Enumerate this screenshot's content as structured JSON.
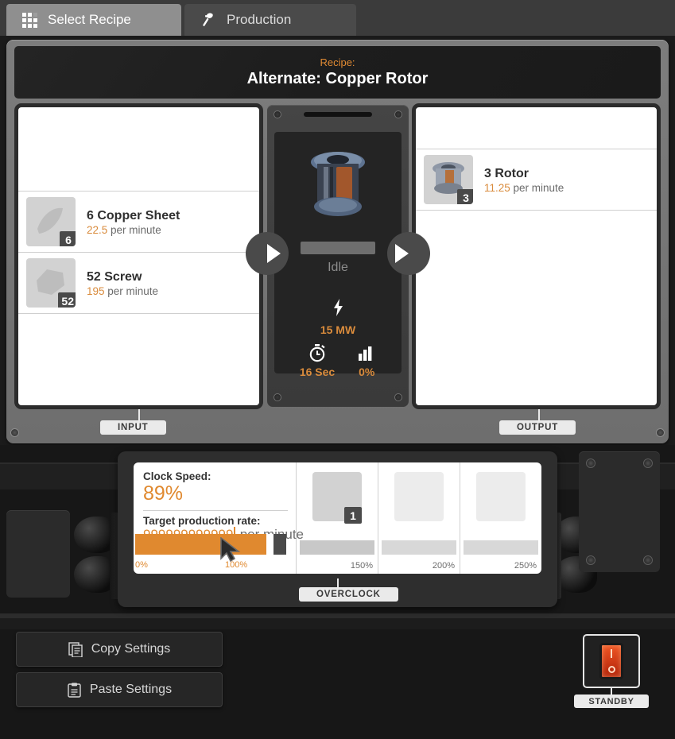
{
  "tabs": [
    {
      "label": "Select Recipe",
      "icon": "grid-icon",
      "active": true
    },
    {
      "label": "Production",
      "icon": "hammer-icon",
      "active": false
    }
  ],
  "recipe": {
    "kicker": "Recipe:",
    "title": "Alternate: Copper Rotor"
  },
  "input": {
    "tag": "INPUT",
    "slots": [
      {
        "name": "6 Copper Sheet",
        "count": "6",
        "rate_value": "22.5",
        "rate_suffix": " per minute"
      },
      {
        "name": "52 Screw",
        "count": "52",
        "rate_value": "195",
        "rate_suffix": " per minute"
      }
    ]
  },
  "output": {
    "tag": "OUTPUT",
    "slots": [
      {
        "name": "3 Rotor",
        "count": "3",
        "rate_value": "11.25",
        "rate_suffix": " per minute"
      }
    ]
  },
  "machine": {
    "state": "Idle",
    "power_icon": "lightning-bolt-icon",
    "power": "15 MW",
    "time_icon": "stopwatch-icon",
    "time": "16 Sec",
    "efficiency_icon": "bar-chart-icon",
    "efficiency": "0%",
    "prev_icon": "arrow-right-icon",
    "next_icon": "arrow-right-icon"
  },
  "overclock": {
    "tag": "OVERCLOCK",
    "clock_speed_label": "Clock Speed:",
    "clock_speed_value": "89%",
    "target_rate_label": "Target production rate:",
    "target_rate_value": "999999999999",
    "target_rate_suffix": " per minute",
    "slider": {
      "min_label": "0%",
      "max_label": "100%",
      "fill_percent": 89
    },
    "shards": [
      {
        "count": "1",
        "percent_label": "150%",
        "filled": true
      },
      {
        "count": "",
        "percent_label": "200%",
        "filled": false
      },
      {
        "count": "",
        "percent_label": "250%",
        "filled": false
      }
    ]
  },
  "footer": {
    "copy_label": "Copy Settings",
    "copy_icon": "document-copy-icon",
    "paste_label": "Paste Settings",
    "paste_icon": "clipboard-paste-icon",
    "standby_label": "STANDBY",
    "standby_icon": "power-rocker-switch-icon"
  },
  "colors": {
    "accent": "#e0892f",
    "panel": "#ffffff",
    "frame": "#7d7d7d",
    "dark": "#242424",
    "standby_red": "#ef5524"
  }
}
